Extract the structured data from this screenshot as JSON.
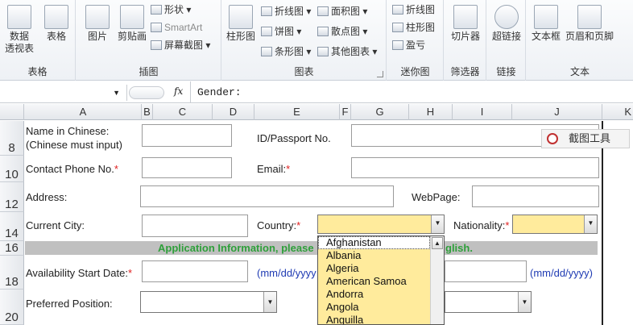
{
  "ribbon": {
    "groups": [
      {
        "label": "表格",
        "buttons": [
          "数据\n透视表",
          "表格"
        ]
      },
      {
        "label": "插图",
        "buttons": [
          "图片",
          "剪贴画"
        ],
        "small": [
          "形状",
          "SmartArt",
          "屏幕截图"
        ]
      },
      {
        "label": "图表",
        "buttons": [
          "柱形图"
        ],
        "small": [
          "折线图",
          "饼图",
          "条形图",
          "面积图",
          "散点图",
          "其他图表"
        ]
      },
      {
        "label": "迷你图",
        "small": [
          "折线图",
          "柱形图",
          "盈亏"
        ]
      },
      {
        "label": "筛选器",
        "buttons": [
          "切片器"
        ]
      },
      {
        "label": "链接",
        "buttons": [
          "超链接"
        ]
      },
      {
        "label": "文本",
        "buttons": [
          "文本框",
          "页眉和页脚"
        ]
      }
    ]
  },
  "formula_bar": {
    "fx": "fx",
    "content": "Gender:"
  },
  "columns": [
    "A",
    "B",
    "C",
    "D",
    "E",
    "F",
    "G",
    "H",
    "I",
    "J",
    "K"
  ],
  "rows": [
    "8",
    "10",
    "12",
    "14",
    "16",
    "18",
    "20"
  ],
  "form": {
    "name_cn_label_1": "Name in Chinese:",
    "name_cn_label_2": "(Chinese must input)",
    "id_label": "ID/Passport No.",
    "phone_label": "Contact Phone No.",
    "email_label": "Email:",
    "address_label": "Address:",
    "webpage_label": "WebPage:",
    "city_label": "Current City:",
    "country_label": "Country:",
    "nationality_label": "Nationality:",
    "required_mark": "*",
    "app_info_banner": "Application Information, please",
    "app_info_banner_tail": "glish.",
    "start_date_label": "Availability Start Date:",
    "date_hint": "(mm/dd/yyyy",
    "date_hint_full": "(mm/dd/yyyy)",
    "position_label": "Preferred Position:"
  },
  "country_dropdown": {
    "options": [
      "Afghanistan",
      "Albania",
      "Algeria",
      "American Samoa",
      "Andorra",
      "Angola",
      "Anguilla"
    ],
    "selected": "Afghanistan"
  },
  "screenshot_tool": {
    "label": "截图工具"
  },
  "colors": {
    "required": "#e02020",
    "banner_text": "#2e9f3a",
    "hint_text": "#1f3bb3",
    "dropdown_bg": "#ffeb9c"
  }
}
